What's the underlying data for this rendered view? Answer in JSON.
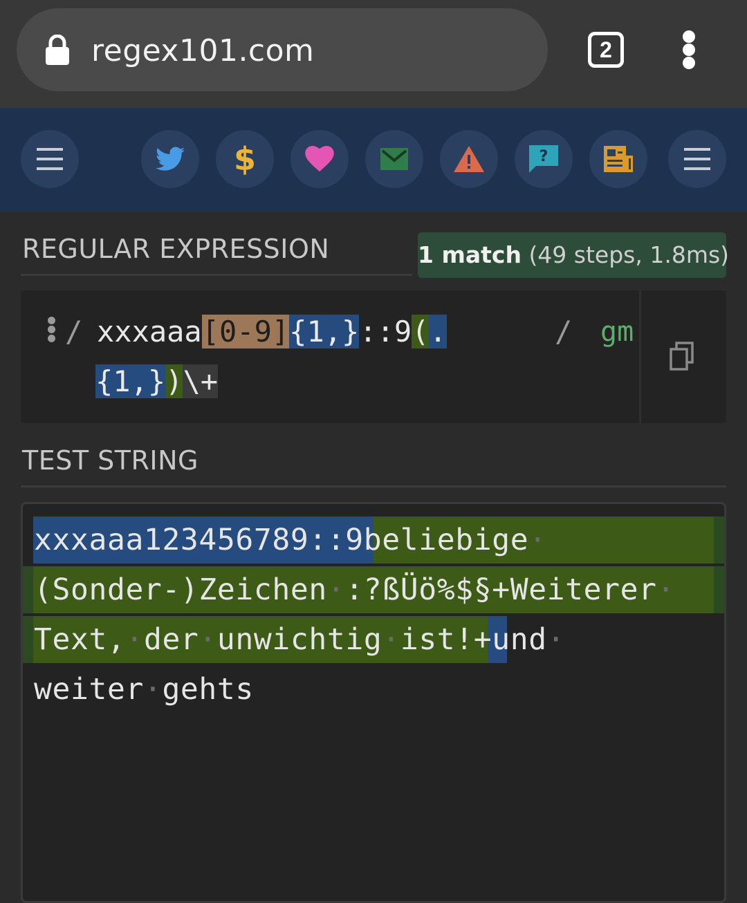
{
  "browser": {
    "url": "regex101.com",
    "tab_count": "2"
  },
  "toolbar": {
    "items": [
      {
        "name": "menu-left",
        "icon": "hamburger-icon"
      },
      {
        "name": "twitter",
        "icon": "twitter-icon"
      },
      {
        "name": "donate",
        "icon": "dollar-icon",
        "glyph": "$"
      },
      {
        "name": "sponsor",
        "icon": "heart-icon"
      },
      {
        "name": "contact",
        "icon": "mail-icon"
      },
      {
        "name": "bug-report",
        "icon": "warning-icon"
      },
      {
        "name": "help",
        "icon": "question-chat-icon"
      },
      {
        "name": "quiz",
        "icon": "newspaper-icon"
      },
      {
        "name": "menu-right",
        "icon": "hamburger-icon"
      }
    ],
    "colors": {
      "background": "#1e3250",
      "button": "#2b4060"
    }
  },
  "regex_section": {
    "title": "REGULAR EXPRESSION",
    "match_count": "1 match",
    "match_detail": "(49 steps, 1.8ms)",
    "delimiter_open": "/",
    "delimiter_close": "/",
    "flags": "gm",
    "pattern": "xxxaaa[0-9]{1,}::9(.{1,})\\+",
    "tokens_line1": [
      "xxxaaa",
      "[0-9]",
      "{1,}",
      "::9",
      "(",
      "."
    ],
    "tokens_line2": [
      "{1,}",
      ")",
      "\\+"
    ]
  },
  "test_section": {
    "title": "TEST STRING",
    "lines": [
      {
        "segments": [
          "xxxaaa123456789::9",
          "beliebige",
          "·"
        ]
      },
      {
        "segments": [
          "(Sonder-)Zeichen",
          "·",
          ":?ßÜö%$§+Weiterer",
          "·"
        ]
      },
      {
        "segments": [
          "Text,",
          "·",
          "der",
          "·",
          "unwichtig",
          "·",
          "ist!",
          "+",
          "und",
          "·"
        ]
      },
      {
        "segments": [
          "weiter",
          "·",
          "gehts"
        ]
      }
    ]
  },
  "colors": {
    "match_full": "#264b7e",
    "group1": "#3d5a16",
    "char_class": "#9c7758",
    "flags": "#5cae6a",
    "badge": "#2d4d3a"
  }
}
